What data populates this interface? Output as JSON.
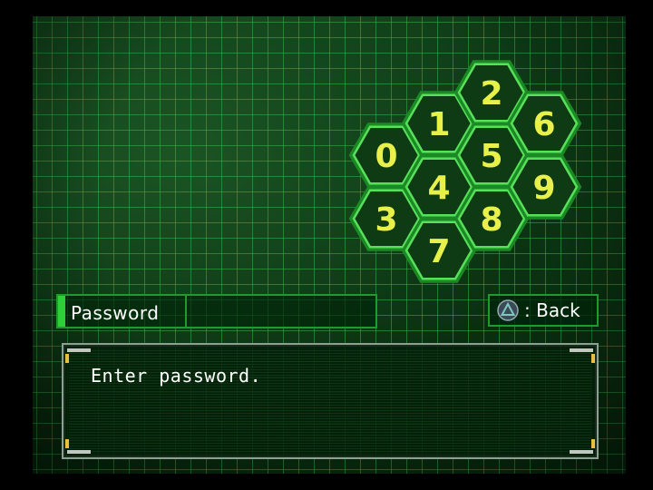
{
  "keypad": {
    "keys": [
      "0",
      "1",
      "2",
      "3",
      "4",
      "5",
      "6",
      "7",
      "8",
      "9"
    ],
    "colors": {
      "hex_fill": "#0f3b14",
      "hex_stroke": "#57e05a",
      "digit": "#e8f04a"
    }
  },
  "password": {
    "label": "Password",
    "value": ""
  },
  "back": {
    "icon": "triangle-button-icon",
    "label": ": Back"
  },
  "message": {
    "text": "Enter password."
  }
}
